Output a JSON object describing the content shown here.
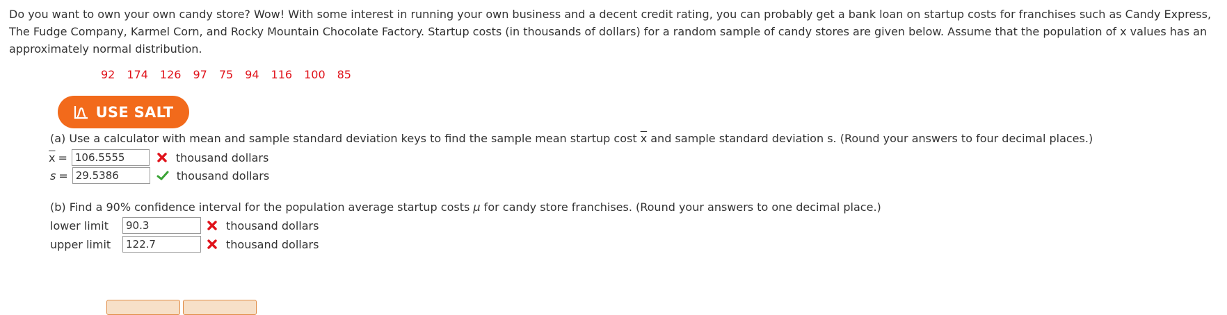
{
  "intro": "Do you want to own your own candy store? Wow! With some interest in running your own business and a decent credit rating, you can probably get a bank loan on startup costs for franchises such as Candy Express, The Fudge Company, Karmel Corn, and Rocky Mountain Chocolate Factory. Startup costs (in thousands of dollars) for a random sample of candy stores are given below. Assume that the population of x values has an approximately normal distribution.",
  "data_values": [
    "92",
    "174",
    "126",
    "97",
    "75",
    "94",
    "116",
    "100",
    "85"
  ],
  "salt_button": {
    "label": "USE SALT",
    "icon": "salt-chart-icon",
    "color": "#f26a1b"
  },
  "part_a": {
    "question_pre": "(a) Use a calculator with mean and sample standard deviation keys to find the sample mean startup cost ",
    "question_var": "x",
    "question_post": " and sample standard deviation s. (Round your answers to four decimal places.)",
    "mean_label": "x",
    "equals": "=",
    "mean_value": "106.5555",
    "mean_status": "incorrect",
    "sd_label": "s",
    "sd_value": "29.5386",
    "sd_status": "correct",
    "unit": "thousand dollars"
  },
  "part_b": {
    "question_pre": "(b) Find a 90% confidence interval for the population average startup costs ",
    "question_var": "μ",
    "question_post": " for candy store franchises. (Round your answers to one decimal place.)",
    "lower_label": "lower limit",
    "lower_value": "90.3",
    "lower_status": "incorrect",
    "upper_label": "upper limit",
    "upper_value": "122.7",
    "upper_status": "incorrect",
    "unit": "thousand dollars"
  },
  "colors": {
    "incorrect": "#e0121a",
    "correct": "#3aa335",
    "data": "#e0121a"
  }
}
